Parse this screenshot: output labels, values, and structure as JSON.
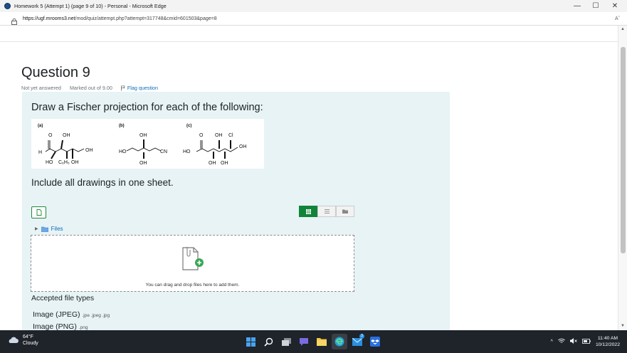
{
  "window": {
    "title": "Homework 5 (Attempt 1) (page 9 of 10) - Personal - Microsoft Edge",
    "minimize": "—",
    "maximize": "☐",
    "close": "✕"
  },
  "browser": {
    "url_host": "https://ugf.mrooms3.net",
    "url_path": "/mod/quiz/attempt.php?attempt=317748&cmid=601503&page=8",
    "read_aloud": "Aˆ"
  },
  "question": {
    "title": "Question 9",
    "status": "Not yet answered",
    "marked": "Marked out of 9.00",
    "flag_label": "Flag question",
    "prompt": "Draw a Fischer projection for each of the following:",
    "instruction": "Include all drawings in one sheet."
  },
  "structures": {
    "a": {
      "label": "(a)",
      "top_labels": [
        "O",
        "OH"
      ],
      "left_labels": [
        "H"
      ],
      "right_labels": [
        "OH"
      ],
      "bottom_labels": [
        "HO",
        "C₆H₅",
        "OH"
      ]
    },
    "b": {
      "label": "(b)",
      "top_labels": [
        "OH"
      ],
      "left_labels": [
        "HO"
      ],
      "right_labels": [
        "CN"
      ],
      "bottom_labels": [
        "OH"
      ]
    },
    "c": {
      "label": "(c)",
      "top_labels": [
        "O",
        "OH",
        "Cl"
      ],
      "left_labels": [
        "HO"
      ],
      "right_labels": [
        "OH"
      ],
      "bottom_labels": [
        "OH",
        "OH"
      ]
    }
  },
  "filepicker": {
    "files_label": "Files",
    "drop_text": "You can drag and drop files here to add them.",
    "accepted_title": "Accepted file types",
    "types": [
      {
        "name": "Image (JPEG)",
        "ext": ".jpe .jpeg .jpg"
      },
      {
        "name": "Image (PNG)",
        "ext": ".png"
      }
    ]
  },
  "taskbar": {
    "temp": "64°F",
    "condition": "Cloudy",
    "time": "11:40 AM",
    "date": "10/12/2022",
    "badge_count": "3"
  },
  "colors": {
    "accent_green": "#11843a",
    "link_blue": "#0f6cbf",
    "question_bg": "#e7f3f5"
  }
}
